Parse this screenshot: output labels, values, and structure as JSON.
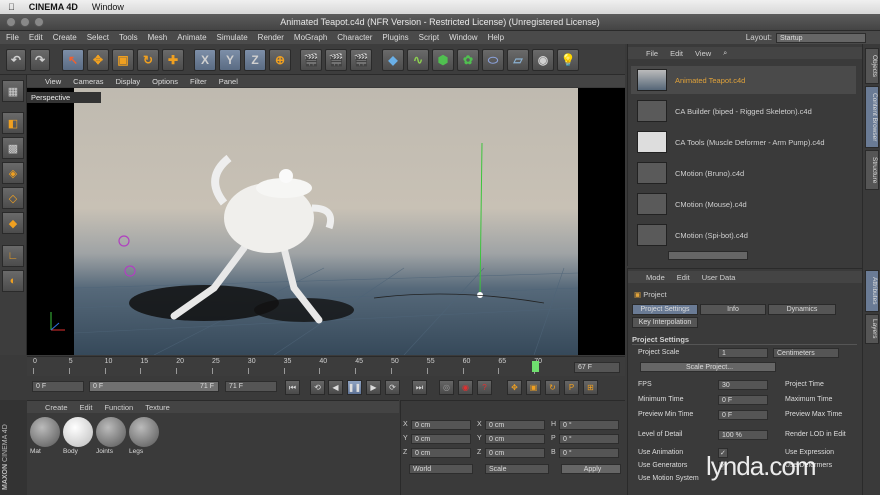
{
  "mac_menu": {
    "app": "CINEMA 4D",
    "window": "Window"
  },
  "window_title": "Animated Teapot.c4d (NFR Version - Restricted License) (Unregistered License)",
  "menu": [
    "File",
    "Edit",
    "Create",
    "Select",
    "Tools",
    "Mesh",
    "Animate",
    "Simulate",
    "Render",
    "MoGraph",
    "Character",
    "Plugins",
    "Script",
    "Window",
    "Help"
  ],
  "layout": {
    "label": "Layout:",
    "value": "Startup"
  },
  "toolbar": {
    "axis_x": "X",
    "axis_y": "Y",
    "axis_z": "Z"
  },
  "viewport": {
    "menu": [
      "View",
      "Cameras",
      "Display",
      "Options",
      "Filter",
      "Panel"
    ],
    "label": "Perspective"
  },
  "timeline": {
    "ticks": [
      "0",
      "5",
      "10",
      "15",
      "20",
      "25",
      "30",
      "35",
      "40",
      "45",
      "50",
      "55",
      "60",
      "65",
      "70"
    ],
    "current_frame": "67 F"
  },
  "transport": {
    "start": "0 F",
    "range_start": "0 F",
    "range_end": "71 F",
    "end": "71 F"
  },
  "materials": {
    "menu": [
      "Create",
      "Edit",
      "Function",
      "Texture"
    ],
    "items": [
      "Mat",
      "Body",
      "Joints",
      "Legs"
    ]
  },
  "maxon": {
    "line1": "MAXON",
    "line2": "CINEMA 4D"
  },
  "coords": {
    "rows": [
      {
        "a": "X",
        "av": "0 cm",
        "b": "X",
        "bv": "0 cm",
        "c": "H",
        "cv": "0 °"
      },
      {
        "a": "Y",
        "av": "0 cm",
        "b": "Y",
        "bv": "0 cm",
        "c": "P",
        "cv": "0 °"
      },
      {
        "a": "Z",
        "av": "0 cm",
        "b": "Z",
        "bv": "0 cm",
        "c": "B",
        "cv": "0 °"
      }
    ],
    "world": "World",
    "scale": "Scale",
    "apply": "Apply"
  },
  "content_browser": {
    "menu": [
      "File",
      "Edit",
      "View"
    ],
    "items": [
      "Animated Teapot.c4d",
      "CA Builder (biped - Rigged Skeleton).c4d",
      "CA Tools (Muscle Deformer - Arm Pump).c4d",
      "CMotion (Bruno).c4d",
      "CMotion (Mouse).c4d",
      "CMotion (Spi-bot).c4d"
    ]
  },
  "attributes": {
    "menu": [
      "Mode",
      "Edit",
      "User Data"
    ],
    "object": "Project",
    "tabs": [
      "Project Settings",
      "Info",
      "Dynamics",
      "Key Interpolation"
    ],
    "section": "Project Settings",
    "project_scale_label": "Project Scale",
    "project_scale_value": "1",
    "project_scale_unit": "Centimeters",
    "scale_button": "Scale Project...",
    "rows": [
      {
        "label": "FPS",
        "value": "30",
        "right": "Project Time"
      },
      {
        "label": "Minimum Time",
        "value": "0 F",
        "right": "Maximum Time"
      },
      {
        "label": "Preview Min Time",
        "value": "0 F",
        "right": "Preview Max Time"
      },
      {
        "label": "Level of Detail",
        "value": "100 %",
        "right": "Render LOD in Edit"
      },
      {
        "label": "Use Animation",
        "value": "✓",
        "right": "Use Expression"
      },
      {
        "label": "Use Generators",
        "value": "✓",
        "right": "Use Deformers"
      },
      {
        "label": "Use Motion System",
        "value": "",
        "right": ""
      }
    ]
  },
  "right_tabs": [
    "Objects",
    "Content Browser",
    "Structure",
    "Attributes",
    "Layers"
  ],
  "watermark": "lynda.com",
  "colors": {
    "accent": "#6a7b95",
    "highlight": "#e0a23a",
    "axis_green": "#3cc43c"
  }
}
